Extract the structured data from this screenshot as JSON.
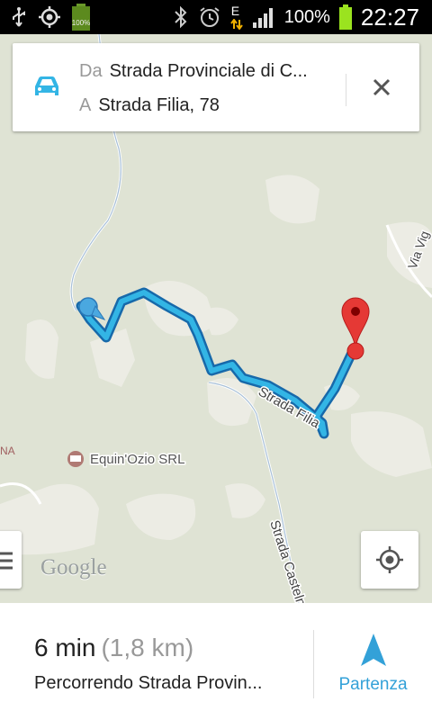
{
  "status_bar": {
    "battery_small_label": "100%",
    "network_type": "E",
    "battery_percent": "100%",
    "time": "22:27",
    "icons": [
      "usb-icon",
      "gps-icon",
      "battery-small-icon",
      "bluetooth-icon",
      "alarm-icon",
      "data-arrows-icon",
      "signal-icon",
      "battery-icon"
    ]
  },
  "route": {
    "from_label": "Da",
    "from_value": "Strada Provinciale di C...",
    "to_label": "A",
    "to_value": "Strada Filia, 78",
    "mode_icon": "car-icon",
    "close_icon": "close-icon"
  },
  "map": {
    "street_labels": [
      "Strada Filia",
      "Strada Castelnuovo",
      "Via Vig"
    ],
    "poi_label": "Equin'Ozio SRL",
    "partial_label": "NA",
    "watermark": "Google",
    "route_color": "#33b5e5",
    "pin_color": "#e53935"
  },
  "summary": {
    "duration": "6 min",
    "distance": "(1,8 km)",
    "via": "Percorrendo Strada Provin...",
    "start_label": "Partenza",
    "accent": "#33a1d8"
  }
}
